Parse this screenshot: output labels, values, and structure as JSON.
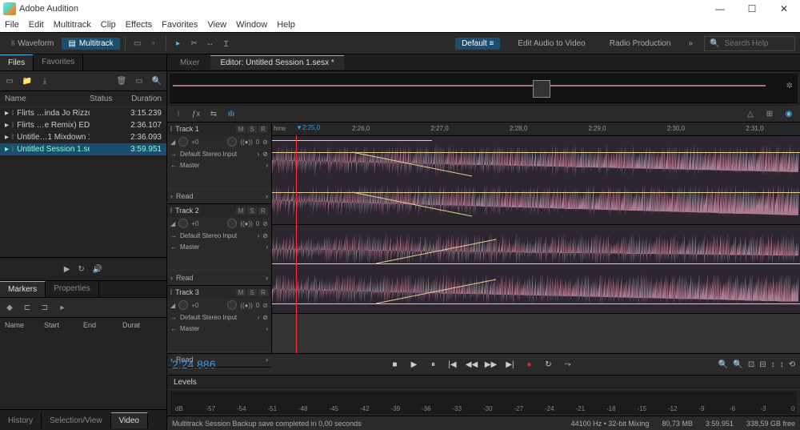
{
  "window": {
    "title": "Adobe Audition"
  },
  "menubar": [
    "File",
    "Edit",
    "Multitrack",
    "Clip",
    "Effects",
    "Favorites",
    "View",
    "Window",
    "Help"
  ],
  "toolbar": {
    "waveform": "Waveform",
    "multitrack": "Multitrack",
    "workspaces": {
      "default": "Default",
      "editAudio": "Edit Audio to Video",
      "radio": "Radio Production"
    },
    "search_placeholder": "Search Help"
  },
  "filesPanel": {
    "tabs": {
      "files": "Files",
      "favorites": "Favorites"
    },
    "columns": {
      "name": "Name",
      "status": "Status",
      "duration": "Duration"
    },
    "rows": [
      {
        "name": "Flirts …inda Jo Rizzo).mp3",
        "duration": "3:15.239",
        "sel": false
      },
      {
        "name": "Flirts …e Remix) EDIT.mp3",
        "duration": "2:36.107",
        "sel": false
      },
      {
        "name": "Untitle…1 Mixdown 1.wav",
        "duration": "2:36.093",
        "sel": false
      },
      {
        "name": "Untitled Session 1.sesx *",
        "duration": "3:59.951",
        "sel": true
      }
    ]
  },
  "markersPanel": {
    "tabs": {
      "markers": "Markers",
      "properties": "Properties"
    },
    "columns": {
      "name": "Name",
      "start": "Start",
      "end": "End",
      "dur": "Durat"
    }
  },
  "bottomTabs": {
    "history": "History",
    "selview": "Selection/View",
    "video": "Video"
  },
  "editorTabs": {
    "mixer": "Mixer",
    "editor": "Editor: Untitled Session 1.sesx *"
  },
  "timeline": {
    "unit": "hms",
    "playheadLabel": "2:25,0",
    "ticks": [
      "2:26,0",
      "2:27,0",
      "2:28,0",
      "2:29,0",
      "2:30,0",
      "2:31,0"
    ]
  },
  "tracks": [
    {
      "name": "Track 1",
      "m": "M",
      "s": "S",
      "r": "R",
      "gain": "+0",
      "pan": "0",
      "input": "Default Stereo Input",
      "output": "Master",
      "automation": "Read",
      "hasAudio": true
    },
    {
      "name": "Track 2",
      "m": "M",
      "s": "S",
      "r": "R",
      "gain": "+0",
      "pan": "0",
      "input": "Default Stereo Input",
      "output": "Master",
      "automation": "Read",
      "hasAudio": true
    },
    {
      "name": "Track 3",
      "m": "M",
      "s": "S",
      "r": "R",
      "gain": "+0",
      "pan": "0",
      "input": "Default Stereo Input",
      "output": "Master",
      "automation": "Read",
      "hasAudio": false
    }
  ],
  "playbar": {
    "timecode": "2:24.886"
  },
  "levels": {
    "label": "Levels",
    "scale": [
      "dB",
      "-57",
      "-54",
      "-51",
      "-48",
      "-45",
      "-42",
      "-39",
      "-36",
      "-33",
      "-30",
      "-27",
      "-24",
      "-21",
      "-18",
      "-15",
      "-12",
      "-9",
      "-6",
      "-3",
      "0"
    ]
  },
  "status": {
    "msg": "Multitrack Session Backup save completed in 0,00 seconds",
    "sr": "44100 Hz",
    "bits": "32-bit Mixing",
    "mem": "80,73 MB",
    "dur": "3:59.951",
    "disk": "338,59 GB free"
  }
}
